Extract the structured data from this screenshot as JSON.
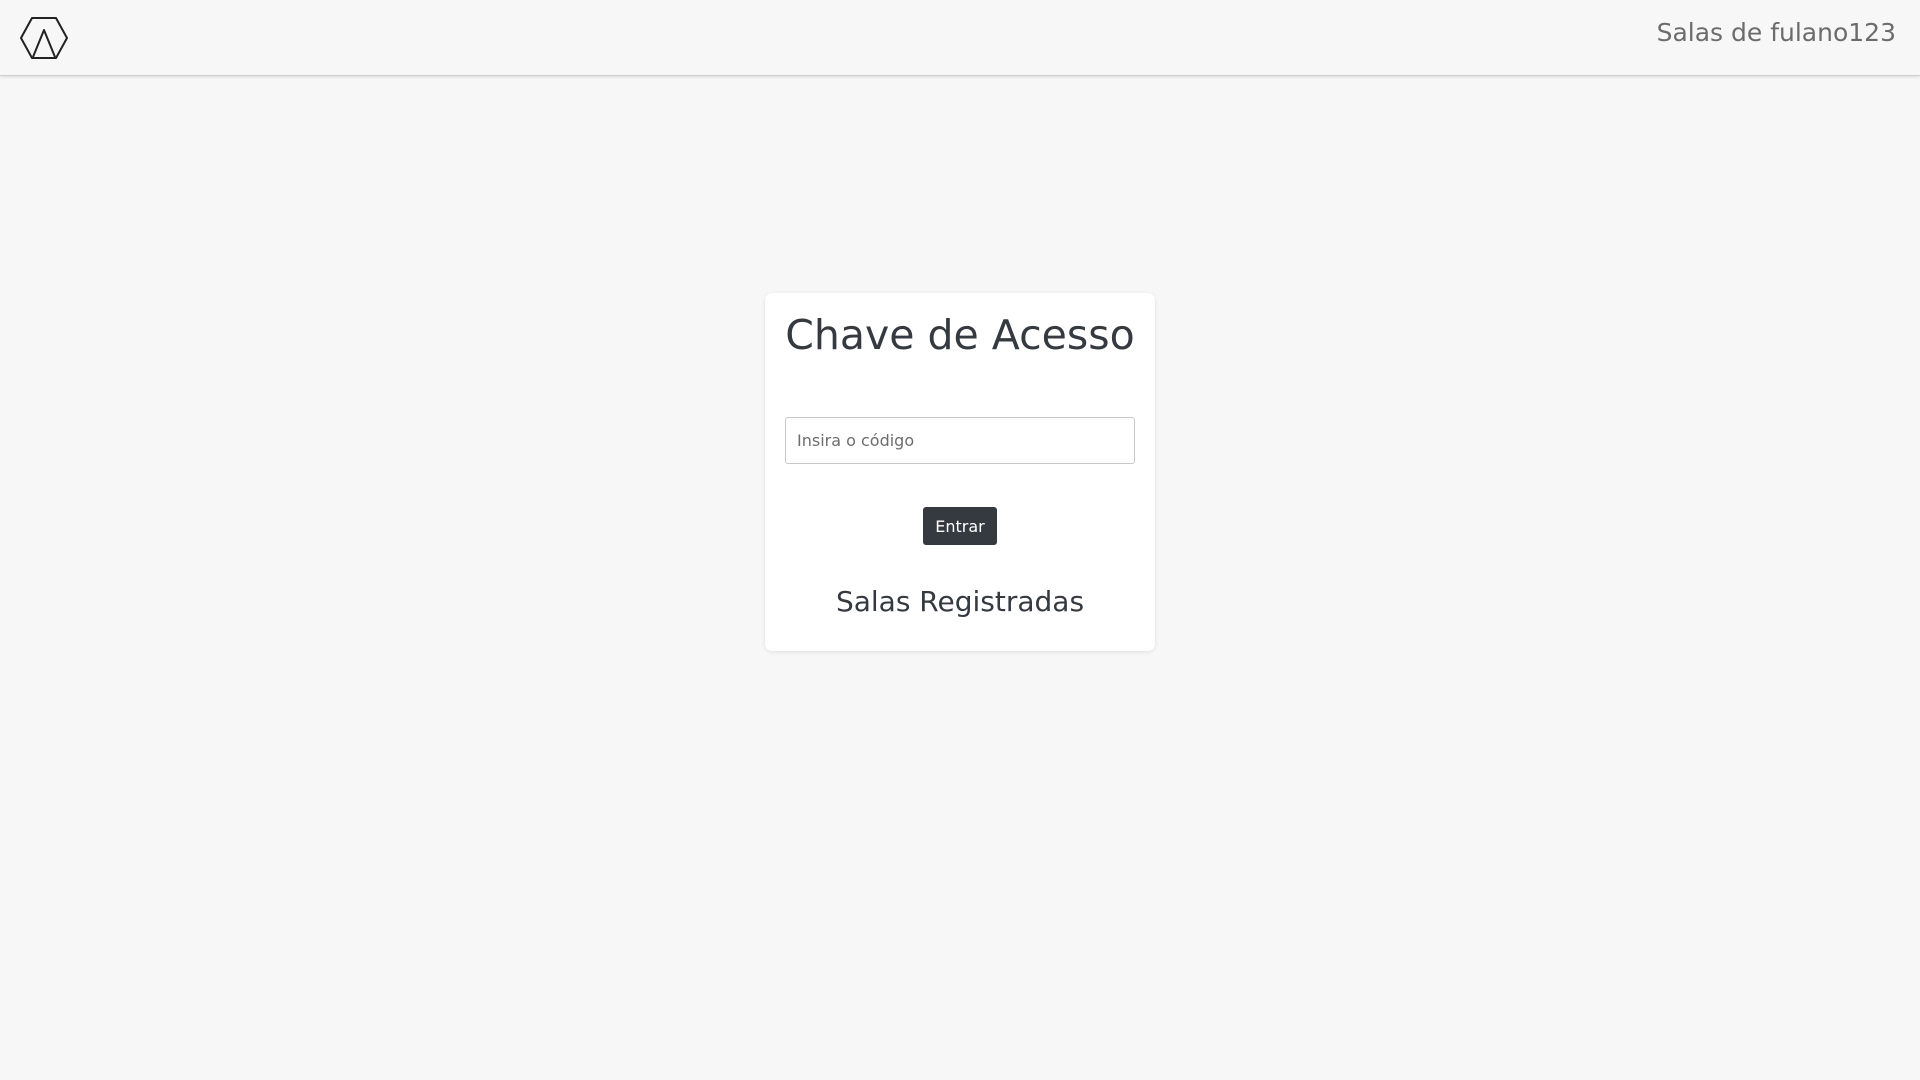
{
  "navbar": {
    "logo_icon": "hexagon-logo-icon",
    "user_rooms_link": "Salas de fulano123"
  },
  "access": {
    "title": "Chave de Acesso",
    "code_placeholder": "Insira o código",
    "code_value": "",
    "enter_label": "Entrar"
  },
  "rooms": {
    "title": "Salas Registradas",
    "items": []
  },
  "colors": {
    "background": "#f7f7f7",
    "card": "#ffffff",
    "primary_dark": "#343a40",
    "muted_text": "#6c6c6c"
  }
}
